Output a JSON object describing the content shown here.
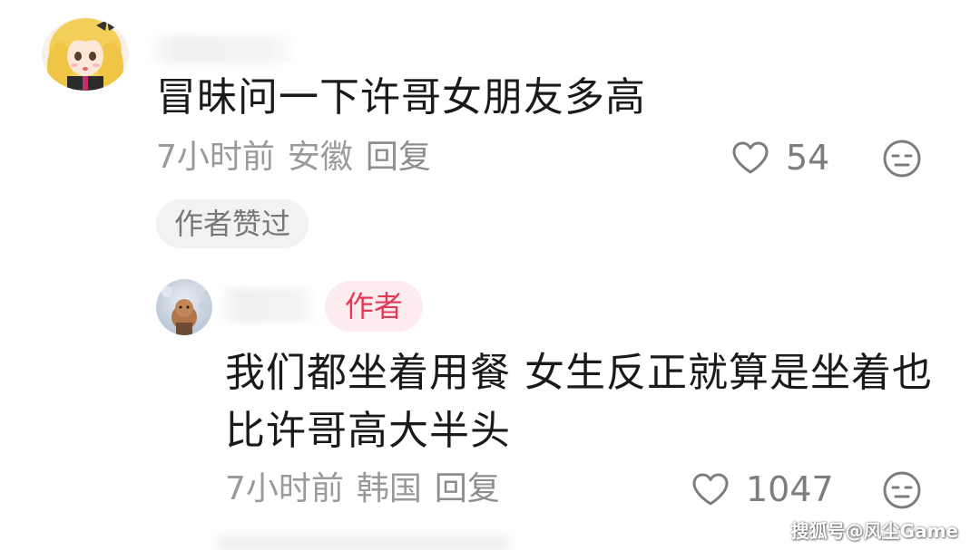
{
  "comments": [
    {
      "text": "冒昧问一下许哥女朋友多高",
      "time": "7小时前",
      "location": "安徽",
      "reply_label": "回复",
      "likes": "54",
      "badge": "作者赞过"
    },
    {
      "author_badge": "作者",
      "text": "我们都坐着用餐 女生反正就算是坐着也比许哥高大半头",
      "time": "7小时前",
      "location": "韩国",
      "reply_label": "回复",
      "likes": "1047"
    }
  ],
  "watermark": "搜狐号@风尘Game",
  "colors": {
    "text": "#1a1a1a",
    "meta": "#9a9a9a",
    "author_accent": "#e23a54",
    "author_badge_bg": "#fdecef",
    "pill_bg": "#f2f2f2"
  },
  "icons": {
    "like": "heart-outline-icon",
    "emoji": "neutral-face-icon"
  }
}
